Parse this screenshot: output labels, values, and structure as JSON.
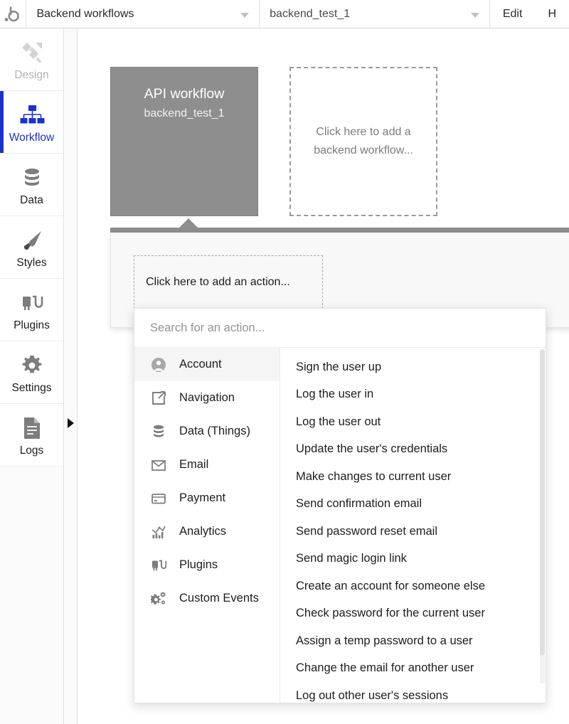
{
  "topbar": {
    "logo": "bubble-logo",
    "workflow_selector": {
      "value": "Backend workflows",
      "icon": "chevron-down-icon"
    },
    "name_selector": {
      "value": "backend_test_1",
      "icon": "chevron-down-icon"
    },
    "edit_label": "Edit",
    "help_label": "H"
  },
  "sidebar": {
    "items": [
      {
        "label": "Design",
        "icon": "design-icon",
        "state": "muted"
      },
      {
        "label": "Workflow",
        "icon": "workflow-icon",
        "state": "active"
      },
      {
        "label": "Data",
        "icon": "data-icon",
        "state": "normal"
      },
      {
        "label": "Styles",
        "icon": "styles-icon",
        "state": "normal"
      },
      {
        "label": "Plugins",
        "icon": "plugins-icon",
        "state": "normal"
      },
      {
        "label": "Settings",
        "icon": "settings-icon",
        "state": "normal"
      },
      {
        "label": "Logs",
        "icon": "logs-icon",
        "state": "normal"
      }
    ],
    "collapse_icon": "triangle-right-icon",
    "active_color": "#1d31d0"
  },
  "canvas": {
    "workflow_card": {
      "title": "API workflow",
      "subtitle": "backend_test_1",
      "color": "#8e8e8e"
    },
    "add_workflow_placeholder": "Click here to add a backend workflow...",
    "add_action_placeholder": "Click here to add an action..."
  },
  "dropdown": {
    "search_placeholder": "Search for an action...",
    "search_value": "",
    "categories": [
      {
        "label": "Account",
        "icon": "user-circle-icon",
        "selected": true
      },
      {
        "label": "Navigation",
        "icon": "share-arrow-icon",
        "selected": false
      },
      {
        "label": "Data (Things)",
        "icon": "database-icon",
        "selected": false
      },
      {
        "label": "Email",
        "icon": "envelope-icon",
        "selected": false
      },
      {
        "label": "Payment",
        "icon": "credit-card-icon",
        "selected": false
      },
      {
        "label": "Analytics",
        "icon": "chart-icon",
        "selected": false
      },
      {
        "label": "Plugins",
        "icon": "plug-icon",
        "selected": false
      },
      {
        "label": "Custom Events",
        "icon": "gears-icon",
        "selected": false
      }
    ],
    "actions": [
      "Sign the user up",
      "Log the user in",
      "Log the user out",
      "Update the user's credentials",
      "Make changes to current user",
      "Send confirmation email",
      "Send password reset email",
      "Send magic login link",
      "Create an account for someone else",
      "Check password for the current user",
      "Assign a temp password to a user",
      "Change the email for another user",
      "Log out other user's sessions"
    ]
  }
}
